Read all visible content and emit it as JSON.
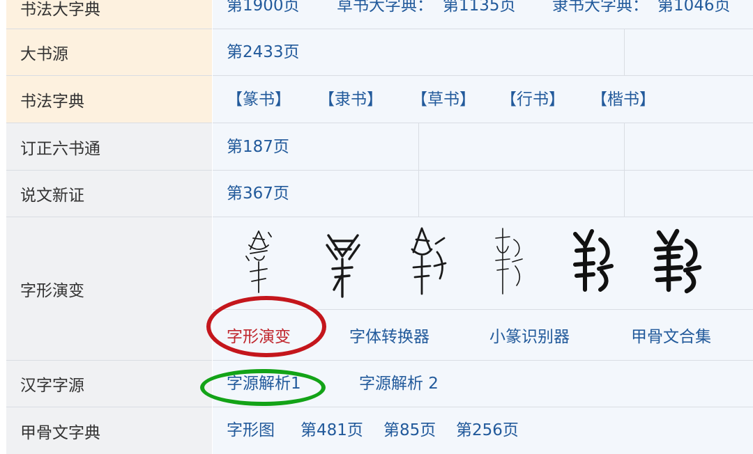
{
  "rows": {
    "shufa_dazidian": {
      "label": "书法大字典",
      "page": "第1900页",
      "caoshu_label": "草书大字典：",
      "caoshu_page": "第1135页",
      "lishu_label": "隶书大字典：",
      "lishu_page": "第1046页"
    },
    "dashuyuan": {
      "label": "大书源",
      "page": "第2433页"
    },
    "shufa_zidian": {
      "label": "书法字典",
      "styles": [
        "【篆书】",
        "【隶书】",
        "【草书】",
        "【行书】",
        "【楷书】"
      ]
    },
    "dingzheng": {
      "label": "订正六书通",
      "page": "第187页"
    },
    "shuowen": {
      "label": "说文新证",
      "page": "第367页"
    },
    "zixing": {
      "label": "字形演变",
      "links": [
        "字形演变",
        "字体转换器",
        "小篆识别器",
        "甲骨文合集"
      ]
    },
    "hanzi": {
      "label": "汉字字源",
      "links": [
        "字源解析1",
        "字源解析 2"
      ]
    },
    "jiagu": {
      "label": "甲骨文字典",
      "links": [
        "字形图",
        "第481页",
        "第85页",
        "第256页"
      ]
    }
  },
  "colors": {
    "link": "#225a9b",
    "highlight_link": "#c0262d",
    "label_peach": "#fdf1df",
    "label_grey": "#f0f1f3",
    "content_bg": "#f3f7fc",
    "red_ring": "#c4161c",
    "green_ring": "#13a317"
  },
  "icons": [
    "glyph-oracle-bone-1",
    "glyph-oracle-bone-2",
    "glyph-bronze",
    "glyph-seal-thin",
    "glyph-seal-bold",
    "glyph-clerical-bold"
  ]
}
